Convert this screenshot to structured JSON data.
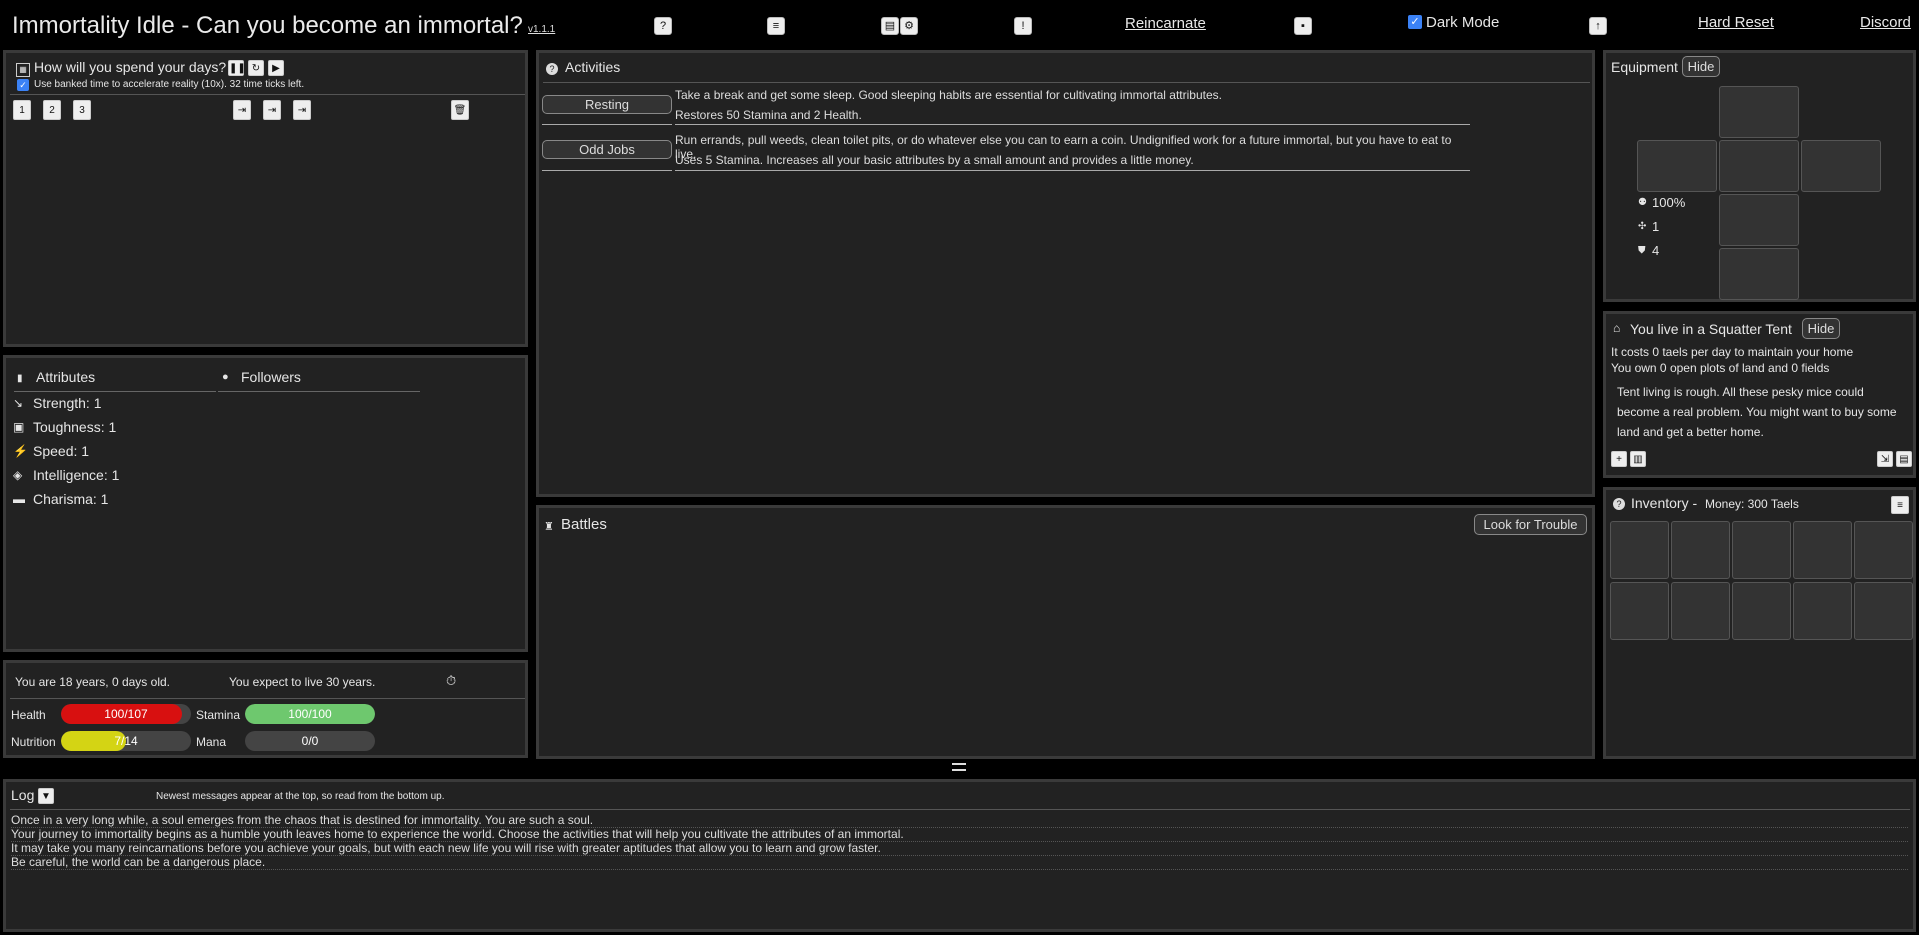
{
  "header": {
    "title": "Immortality Idle - Can you become an immortal?",
    "version": "v1.1.1",
    "reincarnate": "Reincarnate",
    "dark_mode": "Dark Mode",
    "hard_reset": "Hard Reset",
    "discord": "Discord"
  },
  "schedule": {
    "title": "How will you spend your days?",
    "bank_text": "Use banked time to accelerate reality (10x). 32 time ticks left."
  },
  "attributes": {
    "tab_attributes": "Attributes",
    "tab_followers": "Followers",
    "items": [
      {
        "label": "Strength: 1",
        "icon": "strength-icon"
      },
      {
        "label": "Toughness: 1",
        "icon": "toughness-icon"
      },
      {
        "label": "Speed: 1",
        "icon": "speed-icon"
      },
      {
        "label": "Intelligence: 1",
        "icon": "intelligence-icon"
      },
      {
        "label": "Charisma: 1",
        "icon": "charisma-icon"
      }
    ]
  },
  "status": {
    "age": "You are 18 years, 0 days old.",
    "expect": "You expect to live 30 years.",
    "health_label": "Health",
    "health": "100/107",
    "stamina_label": "Stamina",
    "stamina": "100/100",
    "nutrition_label": "Nutrition",
    "nutrition": "7/14",
    "mana_label": "Mana",
    "mana": "0/0",
    "health_fraction": 0.93,
    "stamina_fraction": 1.0,
    "nutrition_fraction": 0.5,
    "mana_fraction": 0.0,
    "colors": {
      "health": "#d81010",
      "stamina": "#6ec86e",
      "nutrition": "#d4d414"
    }
  },
  "activities": {
    "title": "Activities",
    "items": [
      {
        "button": "Resting",
        "line1": "Take a break and get some sleep. Good sleeping habits are essential for cultivating immortal attributes.",
        "line2": "Restores 50 Stamina and 2 Health."
      },
      {
        "button": "Odd Jobs",
        "line1": "Run errands, pull weeds, clean toilet pits, or do whatever else you can to earn a coin. Undignified work for a future immortal, but you have to eat to live.",
        "line2": "Uses 5 Stamina. Increases all your basic attributes by a small amount and provides a little money."
      }
    ]
  },
  "battles": {
    "title": "Battles",
    "look_button": "Look for Trouble"
  },
  "equipment": {
    "title": "Equipment",
    "hide": "Hide",
    "stat_1": "100%",
    "stat_2": "1",
    "stat_3": "4"
  },
  "home": {
    "title": "You live in a Squatter Tent",
    "hide": "Hide",
    "cost": "It costs 0 taels per day to maintain your home",
    "land": "You own 0 open plots of land and 0 fields",
    "desc": "Tent living is rough. All these pesky mice could become a real problem. You might want to buy some land and get a better home."
  },
  "inventory": {
    "title": "Inventory -",
    "money": "Money:  300 Taels"
  },
  "log": {
    "title": "Log",
    "hint": "Newest messages appear at the top, so read from the bottom up.",
    "lines": [
      "Once in a very long while, a soul emerges from the chaos that is destined for immortality. You are such a soul.",
      "Your journey to immortality begins as a humble youth leaves home to experience the world. Choose the activities that will help you cultivate the attributes of an immortal.",
      "It may take you many reincarnations before you achieve your goals, but with each new life you will rise with greater aptitudes that allow you to learn and grow faster.",
      "Be careful, the world can be a dangerous place."
    ]
  }
}
